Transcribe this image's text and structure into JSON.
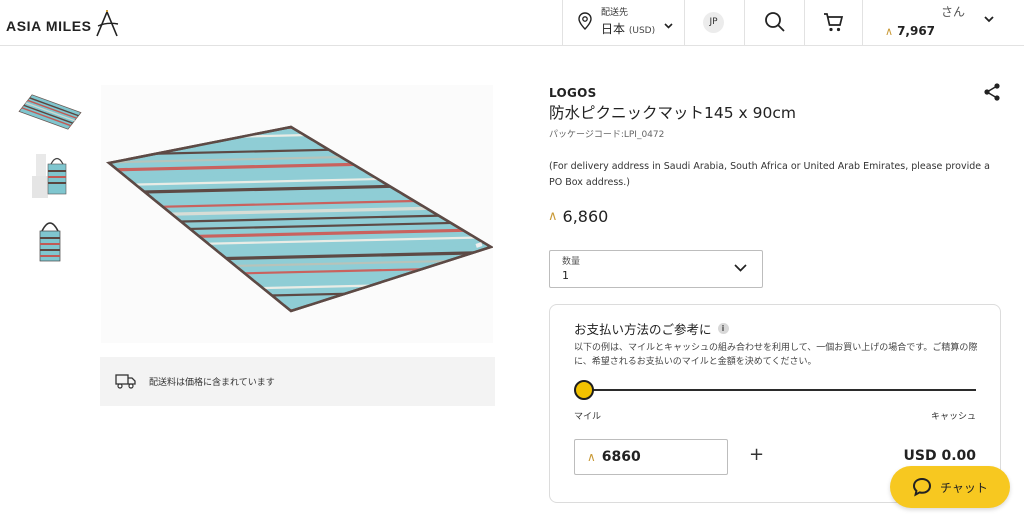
{
  "header": {
    "logo_text": "ASIA MILES",
    "deliver_label": "配送先",
    "deliver_country": "日本",
    "deliver_currency": "(USD)",
    "language": "JP",
    "greeting": "さん",
    "miles_balance": "7,967"
  },
  "gallery": {
    "thumbnails": [
      "mat-flat",
      "mat-bag-carry",
      "mat-bag"
    ]
  },
  "shipping": {
    "text": "配送料は価格に含まれています"
  },
  "product": {
    "brand": "LOGOS",
    "title": "防水ピクニックマット145 x 90cm",
    "package_code": "パッケージコード:LPI_0472",
    "note": "(For delivery address in Saudi Arabia, South Africa or United Arab Emirates, please provide a PO Box address.)",
    "price": "6,860"
  },
  "quantity": {
    "label": "数量",
    "value": "1"
  },
  "payment": {
    "title": "お支払い方法のご参考に",
    "description": "以下の例は、マイルとキャッシュの組み合わせを利用して、一個お買い上げの場合です。ご精算の際に、希望されるお支払いのマイルと金額を決めてください。",
    "slider_value": 0,
    "miles_label": "マイル",
    "cash_label": "キャッシュ",
    "miles_value": "6860",
    "plus_symbol": "+",
    "cash_value": "USD 0.00"
  },
  "chat": {
    "label": "チャット"
  },
  "colors": {
    "accent": "#f7c820",
    "miles_glyph": "#c99a38"
  }
}
